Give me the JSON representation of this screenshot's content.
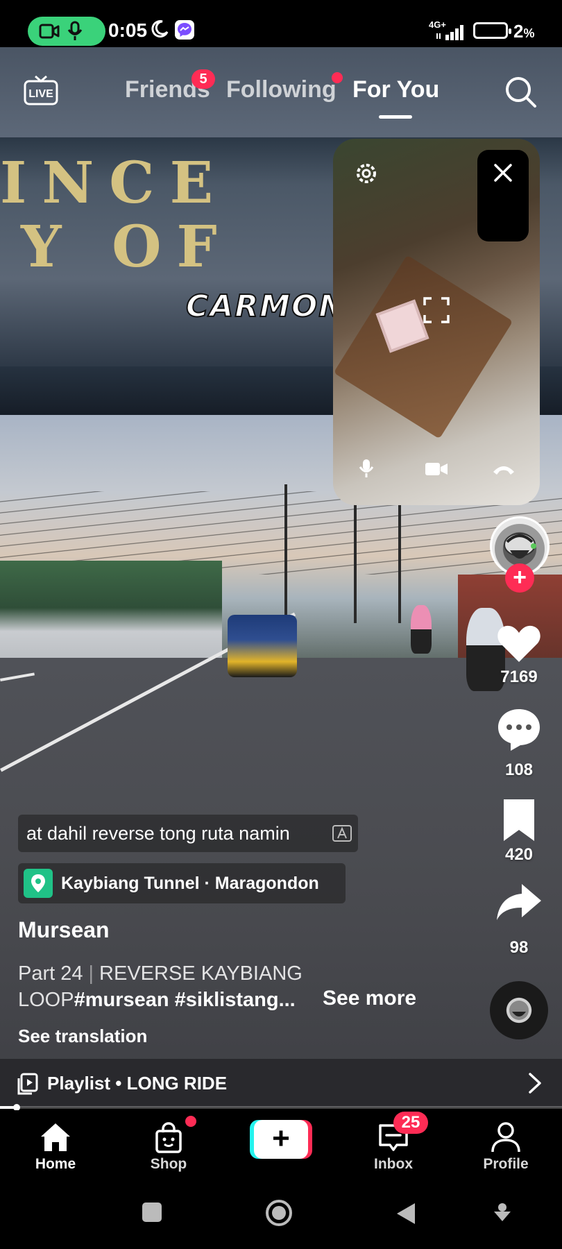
{
  "status_bar": {
    "time": "0:05",
    "network": "4G+",
    "battery": "2",
    "battery_unit": "%",
    "icons": [
      "video-call-icon",
      "mic-icon",
      "moon-icon",
      "messenger-icon",
      "signal-icon",
      "battery-icon"
    ],
    "call_pill_color": "#3ad27a"
  },
  "top_nav": {
    "tabs": [
      {
        "label": "Friends",
        "badge": "5"
      },
      {
        "label": "Following",
        "dot": true
      },
      {
        "label": "For You",
        "active": true
      }
    ],
    "live_label": "LIVE",
    "icons": [
      "live-icon",
      "search-icon"
    ]
  },
  "video": {
    "overlay_text": "CARMON",
    "sign_letters_line1": "INCE   O",
    "sign_letters_line2": "Y OF"
  },
  "pip_call": {
    "icons": [
      "settings-icon",
      "close-icon",
      "fullscreen-icon",
      "mic-icon",
      "camera-icon",
      "hang-up-icon"
    ]
  },
  "actions": {
    "like_count": "7169",
    "comment_count": "108",
    "save_count": "420",
    "share_count": "98",
    "follow_symbol": "+",
    "accent": "#fe2c55"
  },
  "caption": {
    "auto_caption": "at dahil reverse tong ruta namin",
    "location": "Kaybiang Tunnel · Maragondon",
    "username": "Mursean",
    "part": "Part 24",
    "separator": "|",
    "title_a": "REVERSE KAYBIANG",
    "title_b": "LOOP",
    "hashtags": "#mursean #siklistang...",
    "see_more": "See more",
    "see_translation": "See translation",
    "location_color": "#20c287"
  },
  "playlist": {
    "label": "Playlist • LONG RIDE",
    "progress": 0.03
  },
  "bottom_nav": {
    "items": [
      {
        "label": "Home",
        "active": true
      },
      {
        "label": "Shop",
        "dot": true
      },
      {
        "label": "+"
      },
      {
        "label": "Inbox",
        "badge": "25"
      },
      {
        "label": "Profile"
      }
    ],
    "create_colors": {
      "left": "#25f4ee",
      "right": "#fe2c55"
    }
  }
}
